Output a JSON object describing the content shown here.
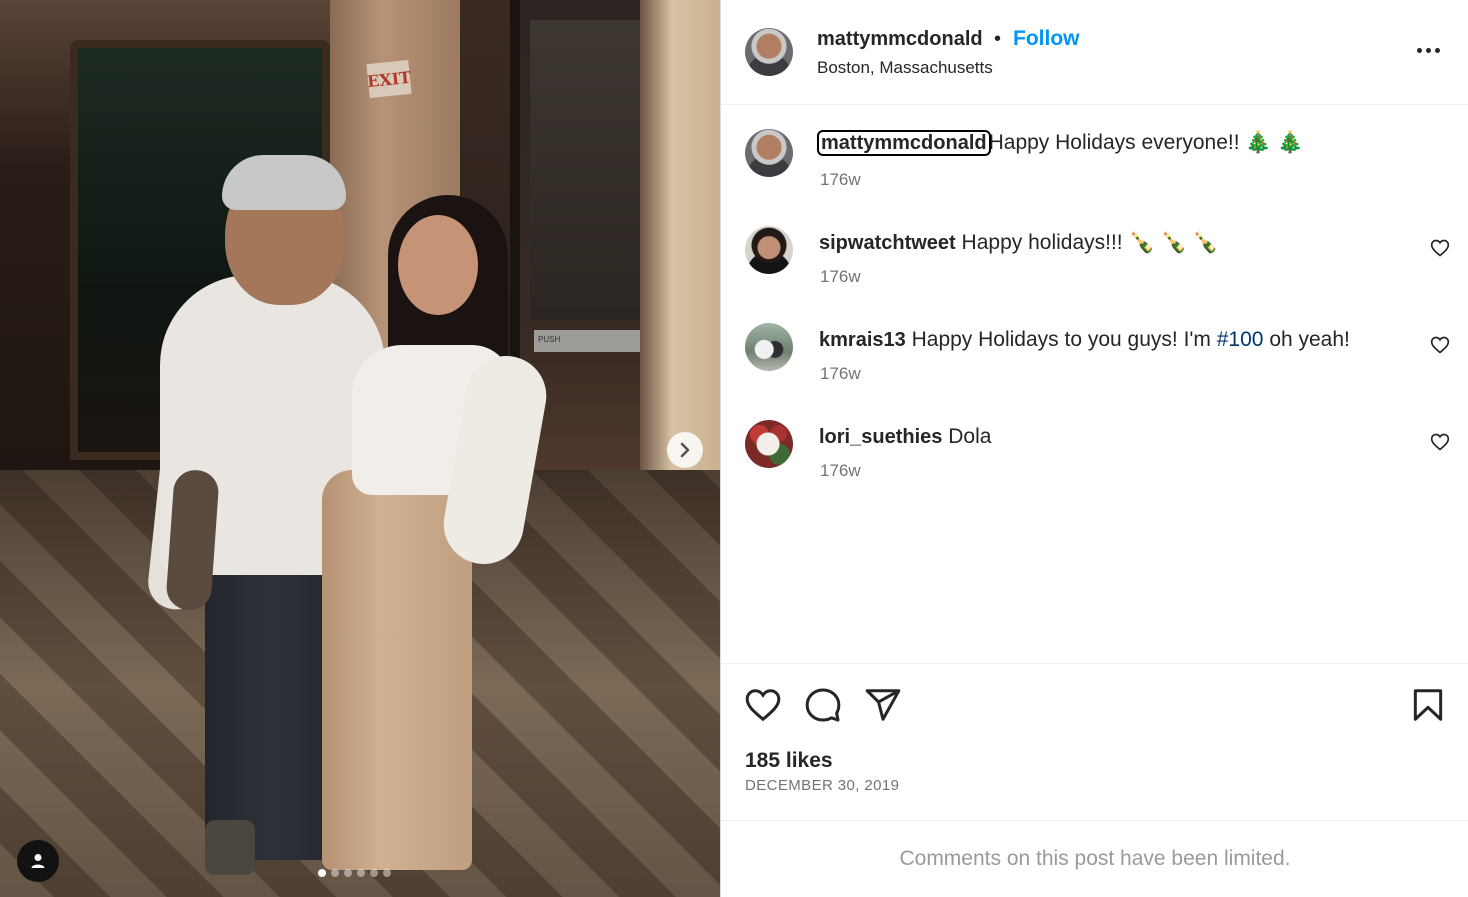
{
  "post": {
    "author": "mattymmcdonald",
    "separator": "•",
    "follow_label": "Follow",
    "location": "Boston, Massachusetts",
    "exit_sign": "EXIT",
    "door_sign": "PUSH",
    "carousel": {
      "slide_count": 6,
      "active_index": 0
    }
  },
  "caption": {
    "username": "mattymmcdonald",
    "text": "Happy Holidays everyone!! 🎄 🎄",
    "time": "176w"
  },
  "comments": [
    {
      "username": "sipwatchtweet",
      "text": "Happy holidays!!! 🍾 🍾 🍾",
      "time": "176w"
    },
    {
      "username": "kmrais13",
      "text_before": "Happy Holidays to you guys! I'm",
      "hashtag": "#100",
      "text_after": "oh yeah!",
      "time": "176w"
    },
    {
      "username": "lori_suethies",
      "text": "Dola",
      "time": "176w"
    }
  ],
  "stats": {
    "likes": "185 likes",
    "date": "DECEMBER 30, 2019"
  },
  "footer": {
    "limited_notice": "Comments on this post have been limited."
  },
  "icons": {
    "like": "heart-icon",
    "comment": "comment-bubble-icon",
    "share": "paper-plane-icon",
    "save": "bookmark-icon",
    "more": "more-options-icon",
    "next": "chevron-right-icon",
    "tags": "user-tag-icon"
  },
  "colors": {
    "accent": "#0095f6",
    "hashtag": "#00376b",
    "muted": "#737373"
  }
}
